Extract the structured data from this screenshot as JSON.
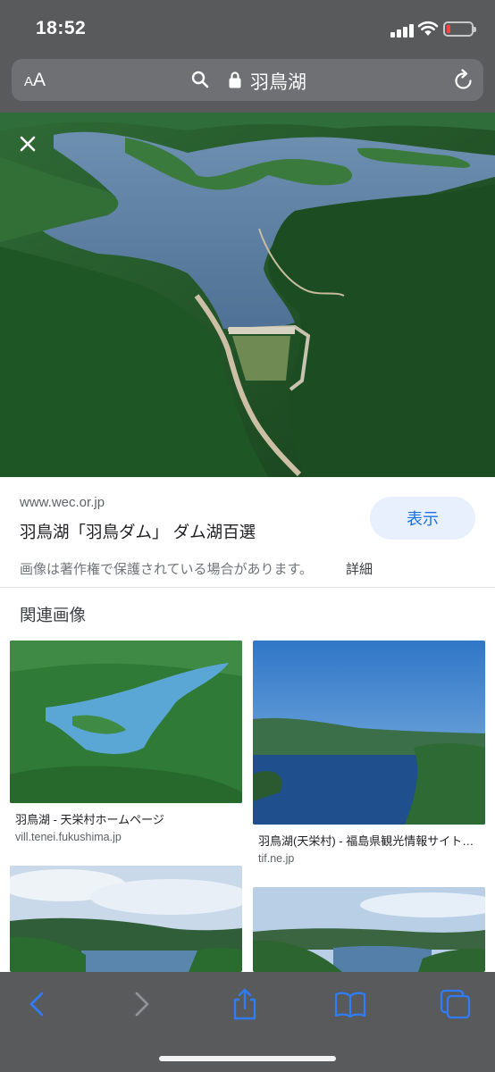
{
  "status": {
    "time": "18:52",
    "battery_level": 0.15
  },
  "browser": {
    "text_size_label": "AA",
    "url_title": "羽鳥湖",
    "icons": [
      "search-icon",
      "lock-icon",
      "reload-icon"
    ]
  },
  "viewer": {
    "close_icon": "close-icon"
  },
  "result": {
    "domain": "www.wec.or.jp",
    "title": "羽鳥湖「羽鳥ダム」 ダム湖百選",
    "view_button": "表示",
    "copyright_notice": "画像は著作権で保護されている場合があります。",
    "details_link": "詳細"
  },
  "related": {
    "heading": "関連画像",
    "items": [
      {
        "caption": "羽鳥湖 - 天栄村ホームページ",
        "source": "vill.tenei.fukushima.jp"
      },
      {
        "caption": "羽鳥湖(天栄村) - 福島県観光情報サイト…",
        "source": "tif.ne.jp"
      },
      {
        "caption": "",
        "source": ""
      },
      {
        "caption": "",
        "source": ""
      }
    ]
  },
  "toolbar": {
    "icons": [
      "back-icon",
      "forward-icon",
      "share-icon",
      "bookmarks-icon",
      "tabs-icon"
    ]
  },
  "colors": {
    "chrome": "#585a5c",
    "accent": "#1a73e8",
    "button_bg": "#e8f0fe",
    "toolbar_icon": "#2f7cf6"
  }
}
